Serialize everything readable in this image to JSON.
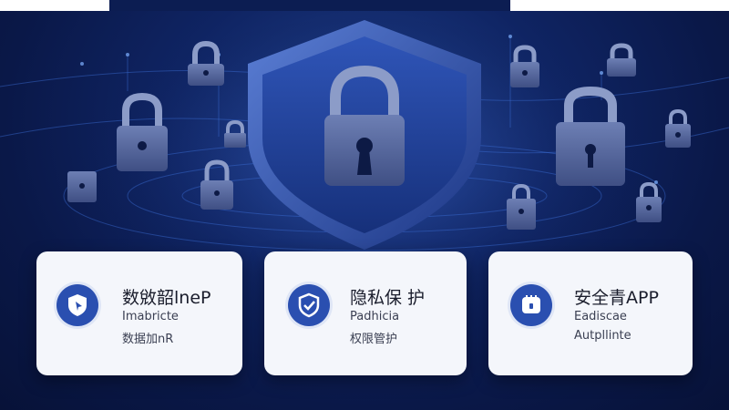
{
  "cards": [
    {
      "icon": "shield-cursor-icon",
      "title": "数敓韶lneP",
      "line1": "Imabricte",
      "line2": "数据加nR"
    },
    {
      "icon": "shield-check-icon",
      "title": "隐私保 护",
      "line1": "Padhicia",
      "line2": "权限管护"
    },
    {
      "icon": "lock-app-icon",
      "title": "安全青APP",
      "line1": "Eadiscae",
      "line2": "Autpllinte"
    }
  ],
  "colors": {
    "background": "#0c1d52",
    "shield": "#2d4fa8",
    "lock": "#5a6a9c",
    "card": "#f4f6fb",
    "icon_circle": "#2a4fb0"
  }
}
